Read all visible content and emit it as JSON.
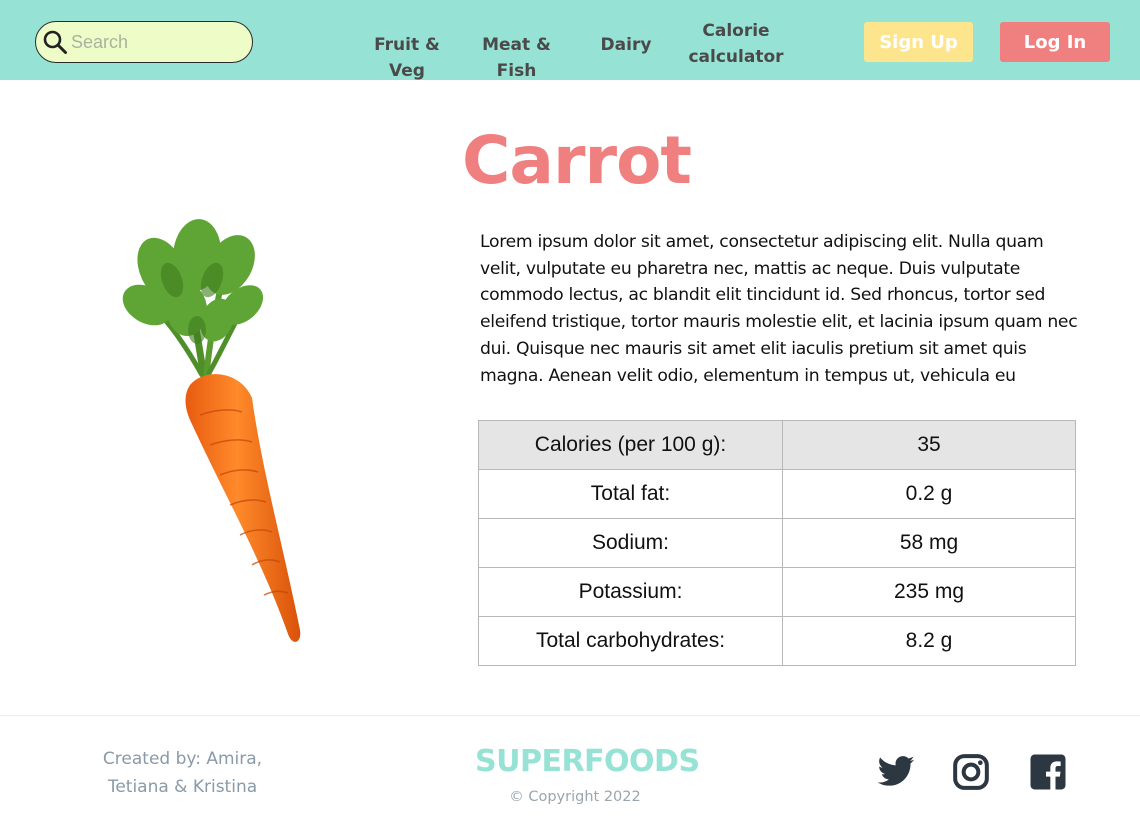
{
  "header": {
    "search": {
      "placeholder": "Search"
    },
    "nav": [
      {
        "label": "Fruit & Veg"
      },
      {
        "label": "Meat & Fish"
      },
      {
        "label": "Dairy"
      },
      {
        "label": "Calorie calculator"
      }
    ],
    "sign_up_label": "Sign Up",
    "log_in_label": "Log In"
  },
  "product": {
    "title": "Carrot",
    "description": "Lorem ipsum dolor sit amet, consectetur adipiscing elit. Nulla quam velit, vulputate eu pharetra nec, mattis ac neque. Duis vulputate commodo lectus, ac blandit elit tincidunt id. Sed rhoncus, tortor sed eleifend tristique, tortor mauris molestie elit, et lacinia ipsum quam nec dui. Quisque nec mauris sit amet elit iaculis pretium sit amet quis magna. Aenean velit odio, elementum in tempus ut, vehicula eu",
    "nutrition": [
      {
        "label": "Calories (per 100 g):",
        "value": "35"
      },
      {
        "label": "Total fat:",
        "value": "0.2 g"
      },
      {
        "label": "Sodium:",
        "value": "58 mg"
      },
      {
        "label": "Potassium:",
        "value": "235 mg"
      },
      {
        "label": "Total carbohydrates:",
        "value": "8.2 g"
      }
    ]
  },
  "footer": {
    "credits_line1": "Created by: Amira,",
    "credits_line2": "Tetiana & Kristina",
    "brand": "SUPERFOODS",
    "copyright": "© Copyright 2022",
    "social_icons": [
      "twitter-icon",
      "instagram-icon",
      "facebook-icon"
    ]
  },
  "colors": {
    "header_bg": "#96e2d5",
    "accent_red": "#f07f7f",
    "sign_up_yellow": "#fde58d",
    "search_bg": "#eefdc8"
  }
}
